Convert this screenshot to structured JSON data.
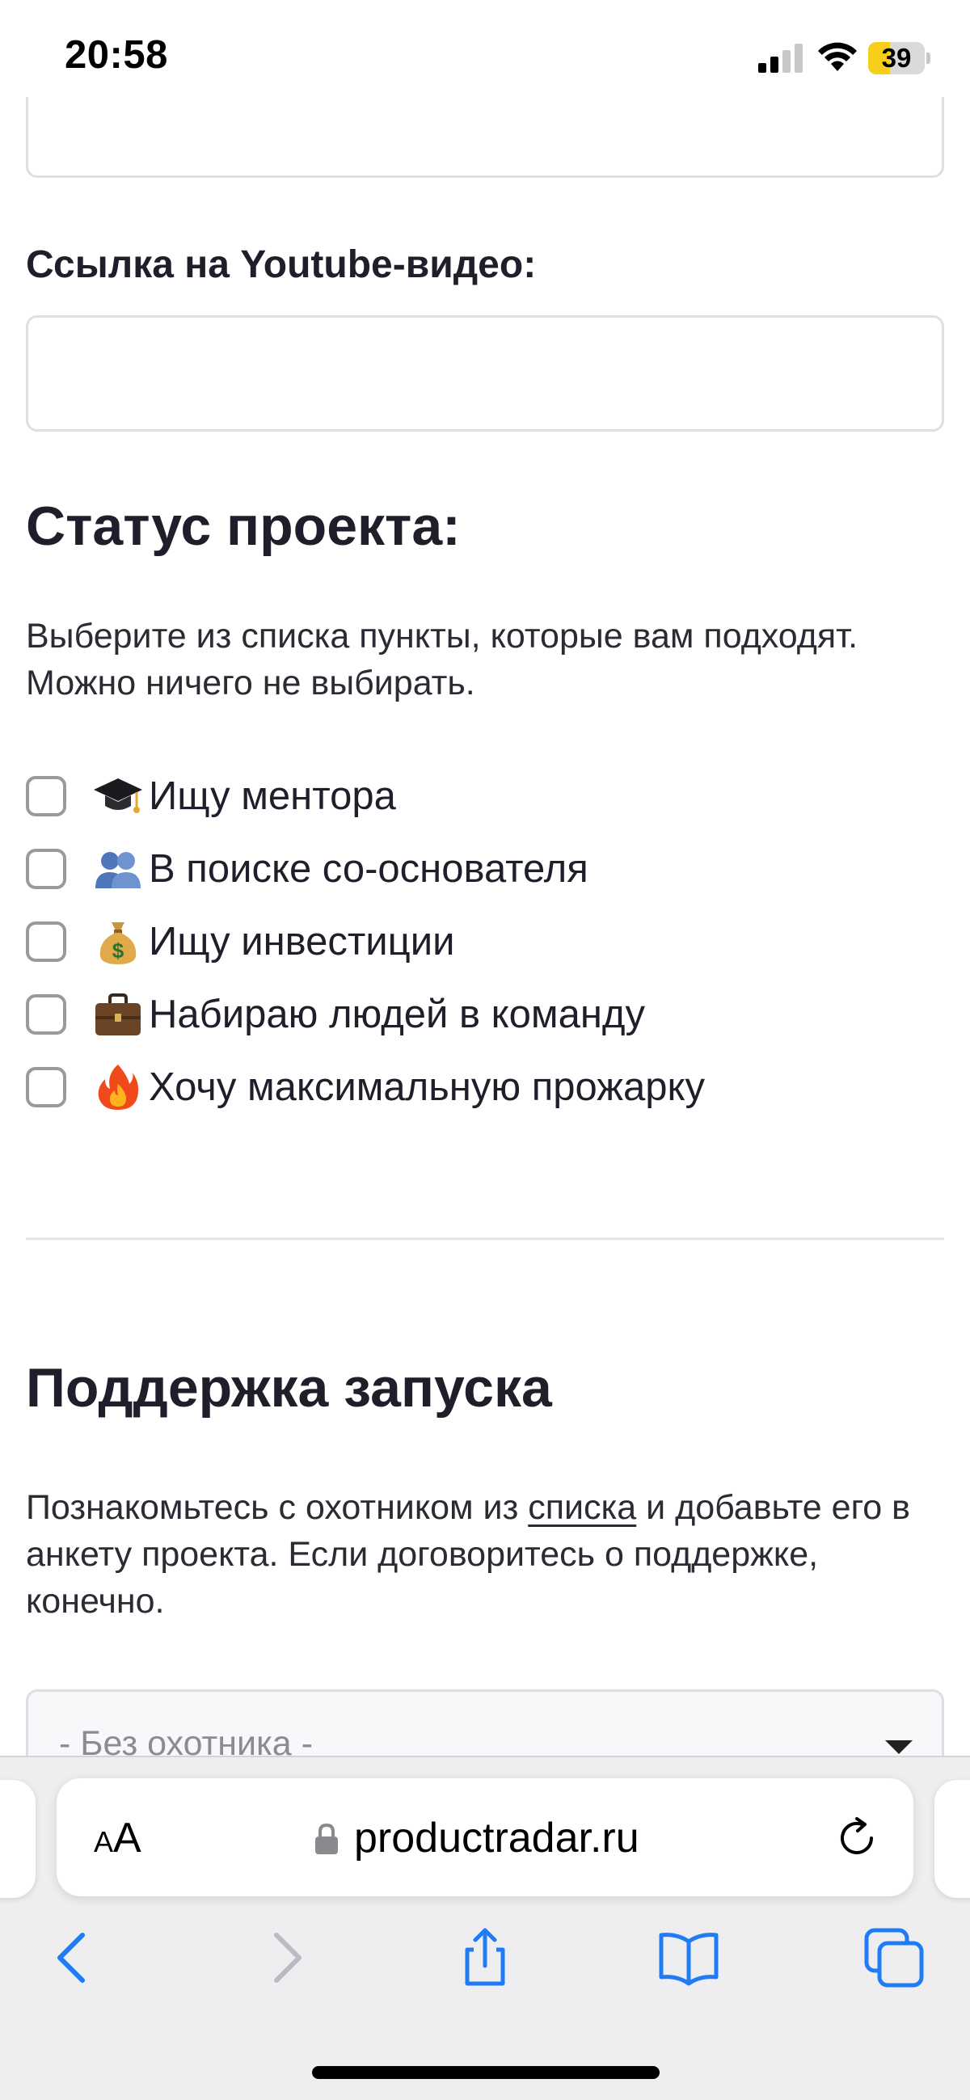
{
  "status_bar": {
    "time": "20:58",
    "battery_level": "39",
    "battery_percent": 39,
    "battery_color": "#f7cf18",
    "icons": [
      "signal-icon",
      "wifi-icon",
      "battery-icon"
    ]
  },
  "form": {
    "youtube_label": "Ссылка на Youtube-видео:",
    "youtube_value": "",
    "top_field_value": ""
  },
  "status_section": {
    "heading": "Статус проекта:",
    "description": "Выберите из списка пункты, которые вам подходят. Можно ничего не выбирать.",
    "options": [
      {
        "icon": "graduation-cap-icon",
        "label": "Ищу ментора",
        "checked": false
      },
      {
        "icon": "people-icon",
        "label": "В поиске со-основателя",
        "checked": false
      },
      {
        "icon": "money-bag-icon",
        "label": "Ищу инвестиции",
        "checked": false
      },
      {
        "icon": "briefcase-icon",
        "label": "Набираю людей в команду",
        "checked": false
      },
      {
        "icon": "fire-icon",
        "label": "Хочу максимальную прожарку",
        "checked": false
      }
    ]
  },
  "support_section": {
    "heading": "Поддержка запуска",
    "description_before_link": "Познакомьтесь с охотником из ",
    "link_text": "списка",
    "description_after_link": " и добавьте его в анкету проекта. Если договоритесь о поддержке, конечно.",
    "select_value": "- Без охотника -"
  },
  "browser": {
    "aa_small": "A",
    "aa_large": "A",
    "url": "productradar.ru",
    "accent_color": "#1f7cf5",
    "icons": [
      "lock-icon",
      "reload-icon",
      "back-icon",
      "forward-icon",
      "share-icon",
      "bookmarks-icon",
      "tabs-icon"
    ]
  }
}
